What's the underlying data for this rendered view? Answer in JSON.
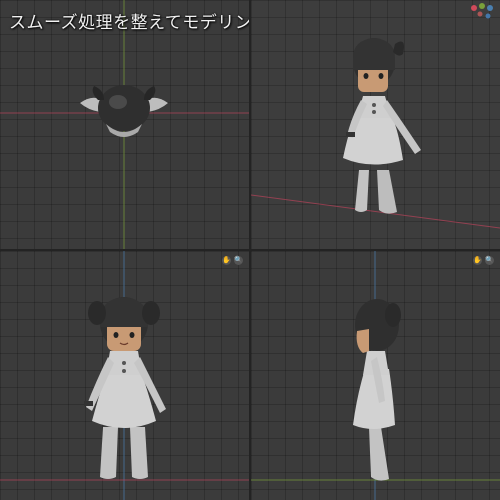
{
  "caption": "スムーズ処理を整えてモデリング完了",
  "icons": {
    "hand": "hand-pan-icon",
    "zoom": "zoom-magnifier-icon"
  },
  "colors": {
    "viewport_bg": "#3b3b3b",
    "axis_x": "#b8435a",
    "axis_y": "#7aa03a",
    "axis_z": "#4a7fb0",
    "model_gray": "#c9c9c9"
  }
}
